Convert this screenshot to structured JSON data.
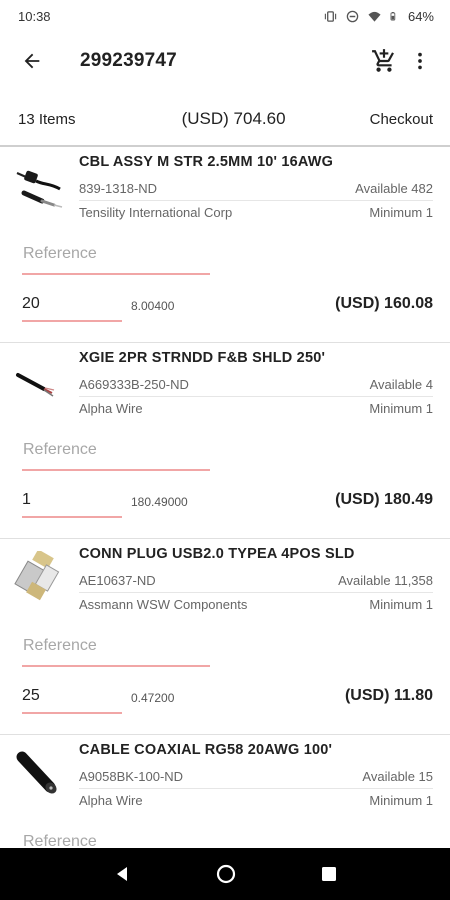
{
  "status": {
    "time": "10:38",
    "battery": "64%"
  },
  "app_bar": {
    "title": "299239747",
    "icons": [
      "back-arrow-icon",
      "add-to-cart-icon",
      "more-vert-icon"
    ]
  },
  "summary": {
    "items_count": "13 Items",
    "total": "(USD) 704.60",
    "checkout_label": "Checkout"
  },
  "reference_placeholder": "Reference",
  "items": [
    {
      "description": "CBL ASSY M STR 2.5MM 10' 16AWG",
      "part_number": "839-1318-ND",
      "available": "Available 482",
      "manufacturer": "Tensility International Corp",
      "minimum": "Minimum 1",
      "quantity": "20",
      "unit_price": "8.00400",
      "extended_price": "(USD) 160.08",
      "thumb": "cable-assembly"
    },
    {
      "description": "XGIE 2PR STRNDD F&B SHLD 250'",
      "part_number": "A669333B-250-ND",
      "available": "Available 4",
      "manufacturer": "Alpha Wire",
      "minimum": "Minimum 1",
      "quantity": "1",
      "unit_price": "180.49000",
      "extended_price": "(USD) 180.49",
      "thumb": "shielded-cable"
    },
    {
      "description": "CONN PLUG USB2.0 TYPEA 4POS SLD",
      "part_number": "AE10637-ND",
      "available": "Available 11,358",
      "manufacturer": "Assmann WSW Components",
      "minimum": "Minimum 1",
      "quantity": "25",
      "unit_price": "0.47200",
      "extended_price": "(USD) 11.80",
      "thumb": "usb-plug"
    },
    {
      "description": "CABLE COAXIAL RG58 20AWG 100'",
      "part_number": "A9058BK-100-ND",
      "available": "Available 15",
      "manufacturer": "Alpha Wire",
      "minimum": "Minimum 1",
      "quantity": "",
      "unit_price": "",
      "extended_price": "",
      "thumb": "coax-cable"
    }
  ],
  "colors": {
    "underline": "#f1a6a6",
    "nav_bar": "#000000"
  }
}
